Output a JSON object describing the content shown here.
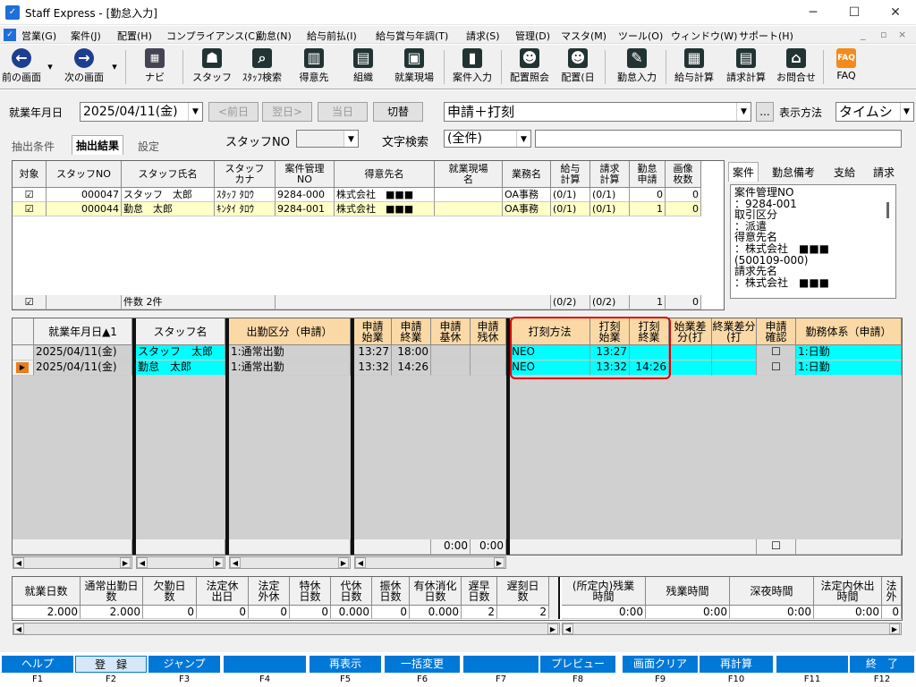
{
  "window": {
    "title": "Staff Express - [勤怠入力]",
    "min": "─",
    "max": "☐",
    "close": "✕"
  },
  "menu": [
    "営業(G)",
    "案件(J)",
    "配置(H)",
    "コンプライアンス(C)",
    "勤怠(N)",
    "給与前払(I)",
    "給与賞与年調(T)",
    "請求(S)",
    "管理(D)",
    "マスタ(M)",
    "ツール(O)",
    "ウィンドウ(W)",
    "サポート(H)"
  ],
  "toolbar": [
    "前の画面",
    "次の画面",
    "ナビ",
    "スタッフ",
    "ｽﾀｯﾌ検索",
    "得意先",
    "組織",
    "就業現場",
    "案件入力",
    "配置照会",
    "配置(日",
    "勤怠入力",
    "給与計算",
    "請求計算",
    "お問合せ",
    "FAQ"
  ],
  "filters": {
    "date_label": "就業年月日",
    "date_value": "2025/04/11(金)",
    "prev_day": "<前日",
    "next_day": "翌日>",
    "today": "当日",
    "switch": "切替",
    "mode_value": "申請＋打刻",
    "more": "...",
    "display_label": "表示方法",
    "display_value": "タイムシ",
    "staff_no_label": "スタッフNO",
    "text_search_label": "文字検索",
    "text_search_value": "(全件)"
  },
  "tabs": {
    "extract_cond": "抽出条件",
    "extract_result": "抽出結果",
    "settings": "設定"
  },
  "upper_grid": {
    "headers": [
      "対象",
      "スタッフNO",
      "スタッフ氏名",
      "スタッフカナ",
      "案件管理NO",
      "得意先名",
      "就業現場名",
      "業務名",
      "給与計算",
      "請求計算",
      "勤怠申請",
      "画像枚数"
    ],
    "rows": [
      {
        "check": "☑",
        "staff_no": "000047",
        "name": "スタッフ　太郎",
        "kana": "ｽﾀｯﾌ ﾀﾛｳ",
        "case_no": "9284-000",
        "client": "株式会社　■■■",
        "site": "",
        "job": "OA事務",
        "pay": "(0/1)",
        "bill": "(0/1)",
        "apply": "0",
        "images": "0"
      },
      {
        "check": "☑",
        "staff_no": "000044",
        "name": "勤怠　太郎",
        "kana": "ｷﾝﾀｲ ﾀﾛｳ",
        "case_no": "9284-001",
        "client": "株式会社　■■■",
        "site": "",
        "job": "OA事務",
        "pay": "(0/1)",
        "bill": "(0/1)",
        "apply": "1",
        "images": "0"
      }
    ],
    "footer": {
      "check": "☑",
      "count": "件数 2件",
      "pay": "(0/2)",
      "bill": "(0/2)",
      "apply": "1",
      "images": "0"
    }
  },
  "side_panel": {
    "tabs": [
      "案件",
      "勤怠備考",
      "支給",
      "請求"
    ],
    "lines": [
      "案件管理NO",
      "：9284-001",
      "取引区分",
      "：派遣",
      "得意先名",
      "：株式会社　■■■",
      "(500109-000)",
      "請求先名",
      "：株式会社　■■■"
    ]
  },
  "lower_grid": {
    "headers": [
      "就業年月日▲1",
      "スタッフ名",
      "出勤区分（申請）",
      "申請始業",
      "申請終業",
      "申請基休",
      "申請残休",
      "打刻方法",
      "打刻始業",
      "打刻終業",
      "始業差分(打",
      "終業差分(打",
      "申請確認",
      "勤務体系（申請）"
    ],
    "rows": [
      {
        "date": "2025/04/11(金)",
        "name": "スタッフ　太郎",
        "kubun": "1:通常出勤",
        "start": "13:27",
        "end": "18:00",
        "method": "NEO",
        "stamp_start": "13:27",
        "stamp_end": "",
        "confirm": "☐",
        "system": "1:日勤"
      },
      {
        "date": "2025/04/11(金)",
        "name": "勤怠　太郎",
        "kubun": "1:通常出勤",
        "start": "13:32",
        "end": "14:26",
        "method": "NEO",
        "stamp_start": "13:32",
        "stamp_end": "14:26",
        "confirm": "☐",
        "system": "1:日勤"
      }
    ],
    "footer": {
      "kyu": "0:00",
      "zan": "0:00",
      "confirm": "☐"
    }
  },
  "summary": {
    "headers": [
      "就業日数",
      "通常出勤日数",
      "欠勤日数",
      "法定休出日",
      "法定外休",
      "特休日数",
      "代休日数",
      "振休日数",
      "有休消化日数",
      "遅早日数",
      "遅刻日数",
      "(所定内)残業時間",
      "残業時間",
      "深夜時間",
      "法定内休出時間",
      "法外"
    ],
    "values": [
      "2.000",
      "2.000",
      "0",
      "0",
      "0",
      "0",
      "0.000",
      "0",
      "0.000",
      "2",
      "2",
      "0:00",
      "0:00",
      "0:00",
      "0:00",
      "0"
    ]
  },
  "fkeys": [
    [
      "ヘルプ",
      "F1"
    ],
    [
      "登　録",
      "F2"
    ],
    [
      "ジャンプ",
      "F3"
    ],
    [
      "",
      "F4"
    ],
    [
      "再表示",
      "F5"
    ],
    [
      "一括変更",
      "F6"
    ],
    [
      "",
      "F7"
    ],
    [
      "プレビュー",
      "F8"
    ],
    [
      "画面クリア",
      "F9"
    ],
    [
      "再計算",
      "F10"
    ],
    [
      "",
      "F11"
    ],
    [
      "終　了",
      "F12"
    ]
  ],
  "colors": {
    "accent": "#0078d7",
    "cyan": "#00ffff",
    "orange_header": "#fbd9a6",
    "highlight_border": "#e00000"
  }
}
